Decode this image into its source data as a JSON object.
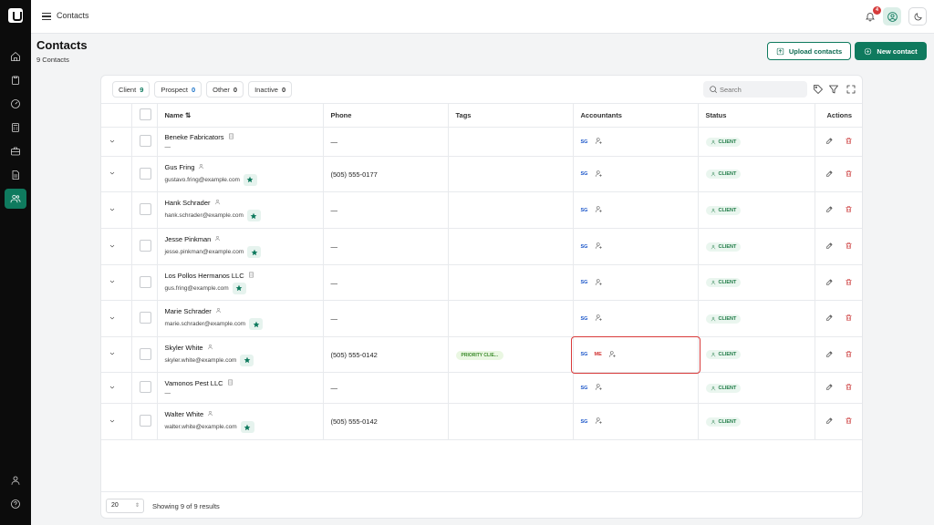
{
  "topbar": {
    "breadcrumb": "Contacts",
    "notification_count": "4"
  },
  "header": {
    "title": "Contacts",
    "subtitle": "9 Contacts",
    "upload_label": "Upload contacts",
    "new_label": "New contact"
  },
  "filters": [
    {
      "label": "Client",
      "count": "9"
    },
    {
      "label": "Prospect",
      "count": "0"
    },
    {
      "label": "Other",
      "count": "0"
    },
    {
      "label": "Inactive",
      "count": "0"
    }
  ],
  "search": {
    "placeholder": "Search"
  },
  "columns": {
    "name": "Name ⇅",
    "phone": "Phone",
    "tags": "Tags",
    "accountants": "Accountants",
    "status": "Status",
    "actions": "Actions"
  },
  "rows": [
    {
      "name": "Beneke Fabricators",
      "sub": "—",
      "phone": "—",
      "tag": "",
      "accountant": "SG",
      "status": "CLIENT"
    },
    {
      "name": "Gus Fring",
      "sub": "gustavo.fring@example.com",
      "phone": "(505) 555-0177",
      "tag": "",
      "accountant": "SG",
      "status": "CLIENT"
    },
    {
      "name": "Hank Schrader",
      "sub": "hank.schrader@example.com",
      "phone": "—",
      "tag": "",
      "accountant": "SG",
      "status": "CLIENT"
    },
    {
      "name": "Jesse Pinkman",
      "sub": "jesse.pinkman@example.com",
      "phone": "—",
      "tag": "",
      "accountant": "SG",
      "status": "CLIENT"
    },
    {
      "name": "Los Pollos Hermanos LLC",
      "sub": "gus.fring@example.com",
      "phone": "—",
      "tag": "",
      "accountant": "SG",
      "status": "CLIENT"
    },
    {
      "name": "Marie Schrader",
      "sub": "marie.schrader@example.com",
      "phone": "—",
      "tag": "",
      "accountant": "SG",
      "status": "CLIENT"
    },
    {
      "name": "Skyler White",
      "sub": "skyler.white@example.com",
      "phone": "(505) 555-0142",
      "tag": "PRIORITY CLIE...",
      "accountant": "SG",
      "accountant2": "ME",
      "status": "CLIENT"
    },
    {
      "name": "Vamonos Pest LLC",
      "sub": "—",
      "phone": "—",
      "tag": "",
      "accountant": "SG",
      "status": "CLIENT"
    },
    {
      "name": "Walter White",
      "sub": "walter.white@example.com",
      "phone": "(505) 555-0142",
      "tag": "",
      "accountant": "SG",
      "status": "CLIENT"
    }
  ],
  "footer": {
    "page_size": "20",
    "showing": "Showing 9 of 9 results"
  },
  "colors": {
    "brand": "#0f7a5e",
    "danger": "#c93030",
    "highlight": "#d93a3a"
  }
}
